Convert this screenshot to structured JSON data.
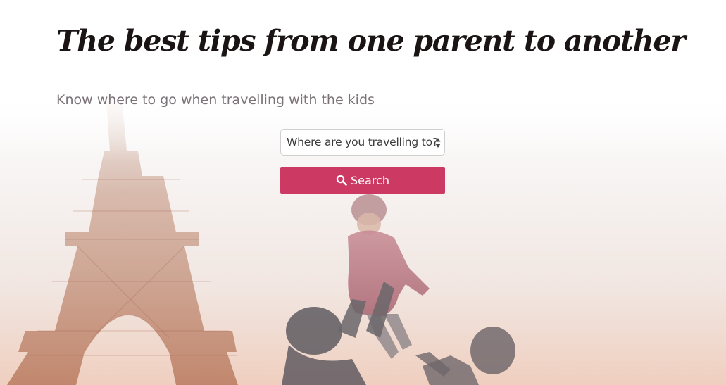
{
  "hero": {
    "headline": "The best tips from one parent to another",
    "subline": "Know where to go when travelling with the kids",
    "background_image": "Eiffel Tower in the haze with a parent lifting a child into the air"
  },
  "search": {
    "destination_select": {
      "selected_value": "Where are you travelling to?"
    },
    "button_label": "Search",
    "button_icon": "search-icon"
  },
  "colors": {
    "accent": "#cc3a63",
    "headline": "#1a1414",
    "subline": "#7b7378"
  }
}
